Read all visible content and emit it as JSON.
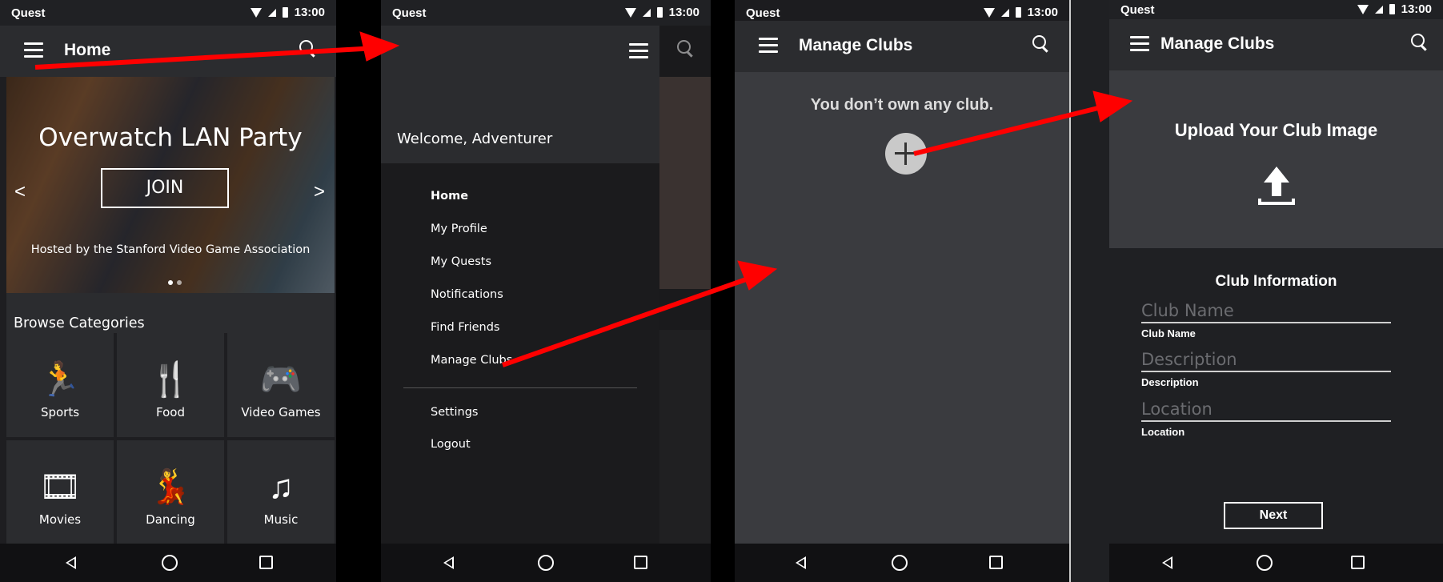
{
  "status": {
    "carrier": "Quest",
    "time": "13:00"
  },
  "screen1": {
    "title": "Home",
    "hero": {
      "event_title": "Overwatch LAN Party",
      "join_label": "JOIN",
      "host": "Hosted by the Stanford Video Game Association",
      "prev": "<",
      "next": ">"
    },
    "browse_title": "Browse Categories",
    "categories": [
      {
        "label": "Sports",
        "icon": "runner-icon",
        "glyph": "🏃"
      },
      {
        "label": "Food",
        "icon": "cutlery-icon",
        "glyph": "🍴"
      },
      {
        "label": "Video Games",
        "icon": "gamepad-icon",
        "glyph": "🎮"
      },
      {
        "label": "Movies",
        "icon": "film-icon",
        "glyph": "🎞"
      },
      {
        "label": "Dancing",
        "icon": "dancers-icon",
        "glyph": "💃"
      },
      {
        "label": "Music",
        "icon": "music-note-icon",
        "glyph": "♫"
      }
    ]
  },
  "screen2": {
    "welcome": "Welcome, Adventurer",
    "menu": [
      "Home",
      "My Profile",
      "My Quests",
      "Notifications",
      "Find Friends",
      "Manage Clubs"
    ],
    "menu2": [
      "Settings",
      "Logout"
    ]
  },
  "screen3": {
    "title": "Manage Clubs",
    "empty_text": "You don’t own any club."
  },
  "screen4": {
    "title": "Manage Clubs",
    "upload_title": "Upload Your Club Image",
    "info_title": "Club Information",
    "fields": [
      {
        "placeholder": "Club Name",
        "label": "Club Name"
      },
      {
        "placeholder": "Description",
        "label": "Description"
      },
      {
        "placeholder": "Location",
        "label": "Location"
      }
    ],
    "next_label": "Next"
  },
  "colors": {
    "arrow": "#ff0000",
    "panel": "#2b2c2f",
    "field_line": "#cfcfcf"
  }
}
